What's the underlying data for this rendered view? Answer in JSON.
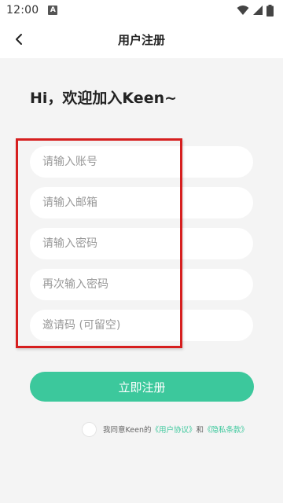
{
  "status_bar": {
    "time": "12:00",
    "notification_badge": "A"
  },
  "header": {
    "title": "用户注册"
  },
  "greeting": "Hi，欢迎加入Keen~",
  "form": {
    "account_placeholder": "请输入账号",
    "email_placeholder": "请输入邮箱",
    "password_placeholder": "请输入密码",
    "password_confirm_placeholder": "再次输入密码",
    "invite_code_placeholder": "邀请码 (可留空)"
  },
  "submit_label": "立即注册",
  "agreement": {
    "prefix": "我同意Keen的",
    "user_agreement": "《用户协议》",
    "conjunction": "和",
    "privacy_policy": "《隐私条款》"
  },
  "colors": {
    "accent": "#3cc89c",
    "annotation_frame": "#d61f1f"
  },
  "icons": {
    "back": "chevron-left-icon",
    "wifi": "wifi-icon",
    "signal": "cellular-signal-icon",
    "battery": "battery-icon"
  }
}
